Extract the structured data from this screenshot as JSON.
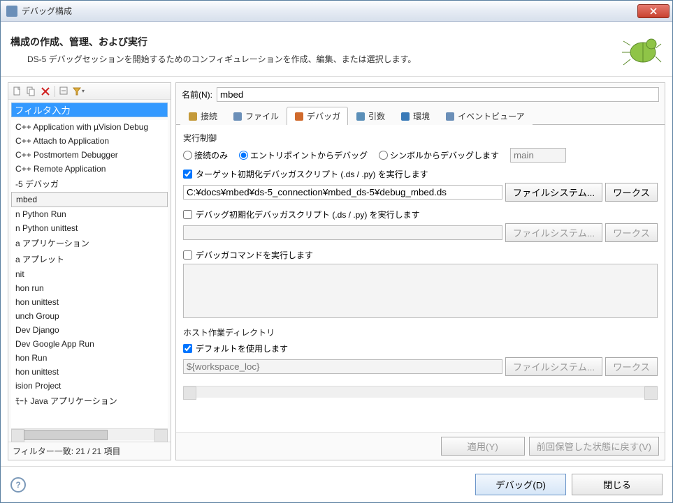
{
  "window": {
    "title": "デバッグ構成"
  },
  "header": {
    "title": "構成の作成、管理、および実行",
    "subtitle": "DS-5 デバッグセッションを開始するためのコンフィギュレーションを作成、編集、または選択します。"
  },
  "left": {
    "filter_placeholder": "フィルタ入力",
    "items": [
      "C++ Application with µVision Debug",
      "C++ Attach to Application",
      "C++ Postmortem Debugger",
      "C++ Remote Application",
      "-5 デバッガ",
      "mbed",
      "n Python Run",
      "n Python unittest",
      "a アプリケーション",
      "a アプレット",
      "nit",
      "hon run",
      "hon unittest",
      "unch Group",
      "Dev Django",
      "Dev Google App Run",
      "hon Run",
      "hon unittest",
      "ision Project",
      "ﾓｰﾄ Java アプリケーション"
    ],
    "selected_index": 5,
    "filter_status": "フィルター一致: 21 / 21 項目"
  },
  "form": {
    "name_label": "名前(N):",
    "name_value": "mbed",
    "tabs": [
      "接続",
      "ファイル",
      "デバッガ",
      "引数",
      "環境",
      "イベントビューア"
    ],
    "active_tab": 2,
    "exec_control": {
      "label": "実行制御",
      "radios": [
        "接続のみ",
        "エントリポイントからデバッグ",
        "シンボルからデバッグします"
      ],
      "selected_radio": 1,
      "symbol_value": "main"
    },
    "target_script": {
      "chk_label": "ターゲット初期化デバッガスクリプト (.ds / .py) を実行します",
      "checked": true,
      "path": "C:¥docs¥mbed¥ds-5_connection¥mbed_ds-5¥debug_mbed.ds"
    },
    "debug_init": {
      "chk_label": "デバッグ初期化デバッガスクリプト (.ds / .py) を実行します",
      "checked": false
    },
    "debugger_cmd": {
      "chk_label": "デバッガコマンドを実行します",
      "checked": false
    },
    "host_dir": {
      "label": "ホスト作業ディレクトリ",
      "use_default_label": "デフォルトを使用します",
      "use_default": true,
      "path": "${workspace_loc}"
    },
    "buttons": {
      "filesystem": "ファイルシステム...",
      "workspace": "ワークス",
      "apply": "適用(Y)",
      "revert": "前回保管した状態に戻す(V)"
    }
  },
  "footer": {
    "debug": "デバッグ(D)",
    "close": "閉じる"
  }
}
